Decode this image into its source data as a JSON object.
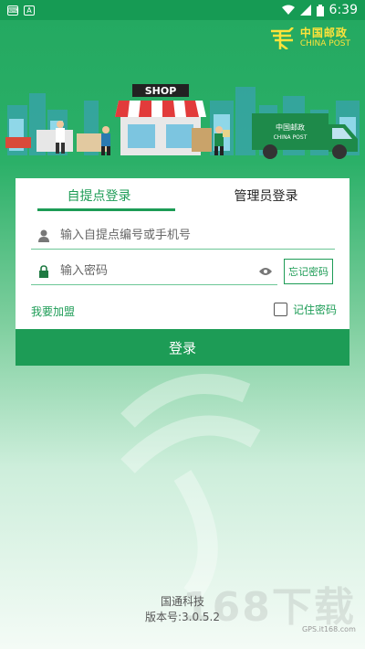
{
  "status": {
    "time": "6:39",
    "left_icons": [
      "keyboard-icon",
      "a-icon"
    ],
    "right_icons": [
      "wifi-icon",
      "signal-icon",
      "battery-icon"
    ]
  },
  "brand": {
    "logo_cn": "中国邮政",
    "logo_en": "CHINA POST",
    "shop_sign": "SHOP",
    "truck_label": "中国邮政",
    "truck_label_en": "CHINA POST"
  },
  "tabs": [
    {
      "label": "自提点登录",
      "active": true
    },
    {
      "label": "管理员登录",
      "active": false
    }
  ],
  "form": {
    "account_placeholder": "输入自提点编号或手机号",
    "password_placeholder": "输入密码",
    "forgot_label": "忘记密码",
    "join_label": "我要加盟",
    "remember_label": "记住密码",
    "remember_checked": false,
    "login_label": "登录"
  },
  "footer": {
    "company": "国通科技",
    "version": "版本号:3.0.5.2"
  },
  "watermark": {
    "text": "168下载",
    "sub": "GPS.it168.com"
  },
  "colors": {
    "primary": "#1d9c56",
    "status_bar": "#169b54",
    "logo": "#ffe33a"
  }
}
